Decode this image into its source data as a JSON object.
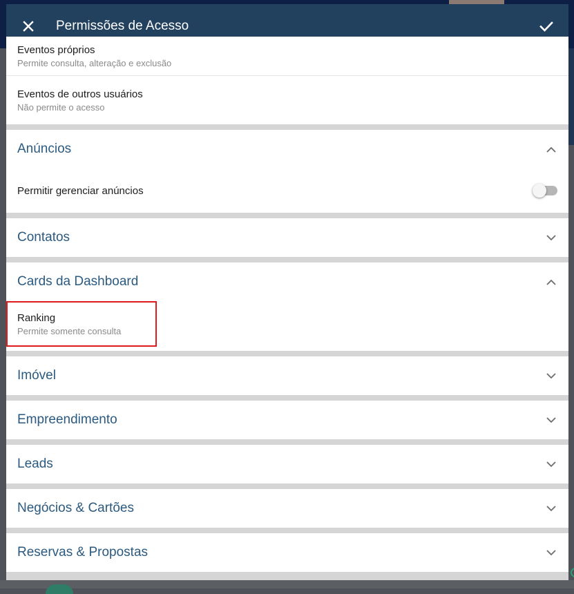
{
  "dialog": {
    "title": "Permissões de Acesso",
    "close_icon": "close-icon",
    "confirm_icon": "check-icon"
  },
  "events": {
    "own": {
      "title": "Eventos próprios",
      "subtitle": "Permite consulta, alteração e exclusão"
    },
    "others": {
      "title": "Eventos de outros usuários",
      "subtitle": "Não permite o acesso"
    }
  },
  "sections": {
    "anuncios": {
      "title": "Anúncios",
      "expanded": true,
      "toggle_label": "Permitir gerenciar anúncios",
      "toggle_on": false
    },
    "contatos": {
      "title": "Contatos",
      "expanded": false
    },
    "dashboard": {
      "title": "Cards da Dashboard",
      "expanded": true,
      "ranking_title": "Ranking",
      "ranking_subtitle": "Permite somente consulta"
    },
    "imovel": {
      "title": "Imóvel",
      "expanded": false
    },
    "empreendimento": {
      "title": "Empreendimento",
      "expanded": false
    },
    "leads": {
      "title": "Leads",
      "expanded": false
    },
    "negocios": {
      "title": "Negócios & Cartões",
      "expanded": false
    },
    "reservas": {
      "title": "Reservas & Propostas",
      "expanded": false
    }
  },
  "colors": {
    "app_bar": "#22415e",
    "section_title": "#2b5a80",
    "highlight_border": "#e01a1a"
  }
}
